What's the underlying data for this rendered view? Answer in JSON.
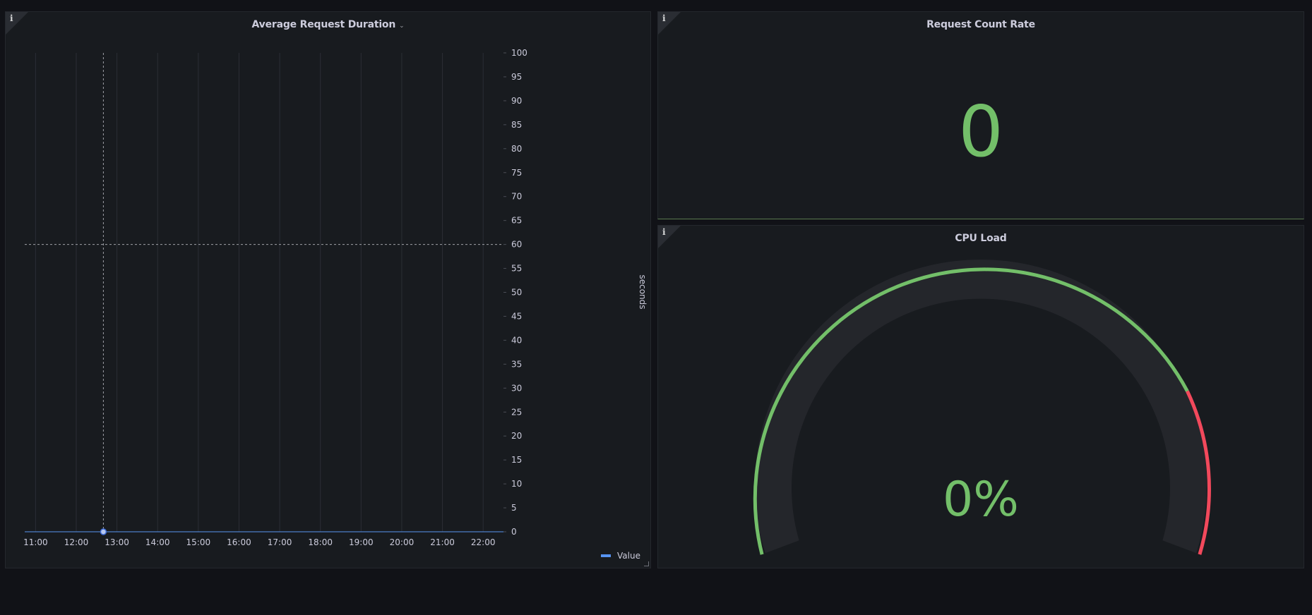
{
  "panels": {
    "avg_request_duration": {
      "title": "Average Request Duration",
      "info_icon": "info-icon",
      "menu_icon": "chevron-down-icon",
      "legend_label": "Value"
    },
    "request_count_rate": {
      "title": "Request Count Rate",
      "info_icon": "info-icon",
      "value": "0"
    },
    "cpu_load": {
      "title": "CPU Load",
      "info_icon": "info-icon",
      "value": "0%",
      "colors": {
        "track": "#24262b",
        "ok": "#73bf69",
        "critical": "#f2495c"
      }
    }
  },
  "colors": {
    "background": "#111217",
    "panel": "#181b1f",
    "series": "#5794f2",
    "stat_green": "#73bf69",
    "grid": "#2b2e35"
  },
  "chart_data": {
    "type": "line",
    "ylabel": "seconds",
    "y_ticks": [
      "0",
      "5",
      "10",
      "15",
      "20",
      "25",
      "30",
      "35",
      "40",
      "45",
      "50",
      "55",
      "60",
      "65",
      "70",
      "75",
      "80",
      "85",
      "90",
      "95",
      "100"
    ],
    "x_ticks": [
      "11:00",
      "12:00",
      "13:00",
      "14:00",
      "15:00",
      "16:00",
      "17:00",
      "18:00",
      "19:00",
      "20:00",
      "21:00",
      "22:00"
    ],
    "ylim": [
      0,
      100
    ],
    "xlim": [
      "10:44",
      "22:30"
    ],
    "y_axis_position": "right",
    "grid": true,
    "legend_position": "bottom-right",
    "series": [
      {
        "name": "Value",
        "color": "#5794f2",
        "x": [
          "10:44",
          "22:30"
        ],
        "values": [
          0,
          0
        ]
      }
    ],
    "hover_crosshair": {
      "x": "12:40",
      "y": 60
    }
  }
}
